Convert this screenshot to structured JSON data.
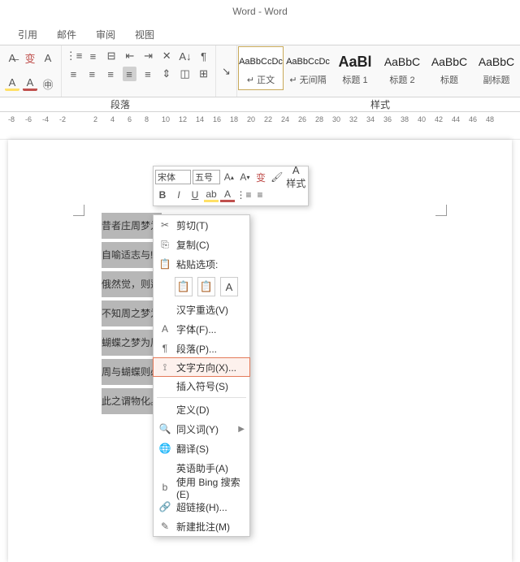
{
  "title": "Word - Word",
  "tabs": [
    "引用",
    "邮件",
    "审阅",
    "视图"
  ],
  "paragraph_group_label": "段落",
  "styles_group_label": "样式",
  "styles": [
    {
      "sample": "AaBbCcDc",
      "name": "↵ 正文",
      "class": ""
    },
    {
      "sample": "AaBbCcDc",
      "name": "↵ 无间隔",
      "class": ""
    },
    {
      "sample": "AaBl",
      "name": "标题 1",
      "class": "big"
    },
    {
      "sample": "AaBbC",
      "name": "标题 2",
      "class": "med"
    },
    {
      "sample": "AaBbC",
      "name": "标题",
      "class": "med"
    },
    {
      "sample": "AaBbC",
      "name": "副标题",
      "class": "med"
    }
  ],
  "ruler_numbers": [
    -8,
    -6,
    -4,
    -2,
    "",
    2,
    4,
    6,
    8,
    10,
    12,
    14,
    16,
    18,
    20,
    22,
    24,
    26,
    28,
    30,
    32,
    34,
    36,
    38,
    40,
    42,
    44,
    46,
    48
  ],
  "doc_lines": [
    "昔者庄周梦为",
    "自喻适志与!",
    "俄然觉，则蘧",
    "不知周之梦为",
    "蝴蝶之梦为周",
    "周与蝴蝶则必",
    "此之谓物化。"
  ],
  "mini": {
    "font": "宋体",
    "size": "五号",
    "styles_label": "样式"
  },
  "context_menu": [
    {
      "icon": "✂",
      "label": "剪切(T)",
      "type": "item"
    },
    {
      "icon": "⎘",
      "label": "复制(C)",
      "type": "item"
    },
    {
      "icon": "📋",
      "label": "粘贴选项:",
      "type": "header"
    },
    {
      "type": "paste_opts"
    },
    {
      "icon": "",
      "label": "汉字重选(V)",
      "type": "item"
    },
    {
      "icon": "A",
      "label": "字体(F)...",
      "type": "item"
    },
    {
      "icon": "¶",
      "label": "段落(P)...",
      "type": "item"
    },
    {
      "icon": "⟟",
      "label": "文字方向(X)...",
      "type": "highlight"
    },
    {
      "icon": "",
      "label": "插入符号(S)",
      "type": "item"
    },
    {
      "type": "sep"
    },
    {
      "icon": "",
      "label": "定义(D)",
      "type": "item"
    },
    {
      "icon": "🔍",
      "label": "同义词(Y)",
      "type": "submenu"
    },
    {
      "icon": "🌐",
      "label": "翻译(S)",
      "type": "item"
    },
    {
      "icon": "",
      "label": "英语助手(A)",
      "type": "item"
    },
    {
      "icon": "b",
      "label": "使用 Bing 搜索(E)",
      "type": "item"
    },
    {
      "icon": "🔗",
      "label": "超链接(H)...",
      "type": "item"
    },
    {
      "icon": "✎",
      "label": "新建批注(M)",
      "type": "item"
    }
  ]
}
